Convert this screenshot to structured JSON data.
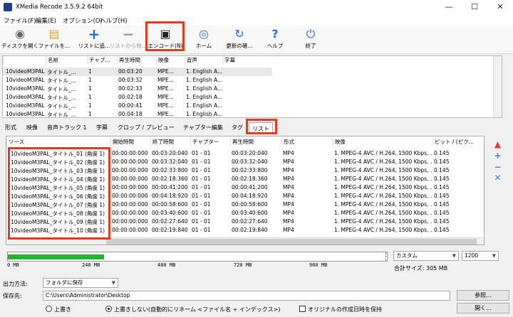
{
  "window": {
    "title": "XMedia Recode 3.5.9.2 64bit"
  },
  "menu": [
    "ファイル(F)",
    "編集(E)",
    "オプション(O)",
    "ヘルプ(H)"
  ],
  "toolbar": [
    {
      "label": "ディスクを開く",
      "icon": "disc-icon",
      "enabled": true
    },
    {
      "label": "ファイルを...",
      "icon": "folder-icon",
      "enabled": true
    },
    {
      "label": "リストに追...",
      "icon": "plus-icon",
      "enabled": true
    },
    {
      "label": "リストから除...",
      "icon": "minus-icon",
      "enabled": false
    },
    {
      "label": "エンコード(N)",
      "icon": "encode-icon",
      "enabled": true
    },
    {
      "label": "ホーム",
      "icon": "globe-icon",
      "enabled": true
    },
    {
      "label": "更新の確...",
      "icon": "refresh-icon",
      "enabled": true
    },
    {
      "label": "ヘルプ",
      "icon": "help-icon",
      "enabled": true
    },
    {
      "label": "終了",
      "icon": "power-icon",
      "enabled": true
    }
  ],
  "file_table": {
    "columns": [
      "",
      "名前",
      "チャプ...",
      "再生時間",
      "映像",
      "音声",
      "字幕"
    ],
    "rows": [
      [
        "10videoM3PAL",
        "タイトル_...",
        "1",
        "00:03:20",
        "MPE...",
        "1. English A...",
        ""
      ],
      [
        "10videoM3PAL",
        "タイトル_...",
        "1",
        "00:03:32",
        "MPE...",
        "1. English A...",
        ""
      ],
      [
        "10videoM3PAL",
        "タイトル_...",
        "1",
        "00:02:33",
        "MPE...",
        "1. English A...",
        ""
      ],
      [
        "10videoM3PAL",
        "タイトル_...",
        "1",
        "00:02:18",
        "MPE...",
        "1. English A...",
        ""
      ],
      [
        "10videoM3PAL",
        "タイトル_...",
        "1",
        "00:00:41",
        "MPE...",
        "1. English A...",
        ""
      ],
      [
        "10videoM3PAL",
        "タイトル_...",
        "1",
        "00:04:18",
        "MPE...",
        "1. English A...",
        ""
      ]
    ]
  },
  "tabs": [
    "形式",
    "映像",
    "音声トラック 1",
    "字幕",
    "クロップ / プレビュー",
    "チャプター編集",
    "タグ",
    "リスト"
  ],
  "list_table": {
    "columns": [
      "ソース",
      "開始時間",
      "終了時間",
      "チャプター",
      "再生時間",
      "形式",
      "映像",
      "ビット / (ピク..."
    ],
    "rows": [
      [
        "10videoM3PAL_タイトル_01 (角度 1)",
        "00:00:00:000",
        "00:03:20:040",
        "01 - 01",
        "00:03:20:040",
        "MP4",
        "1. MPEG-4 AVC / H.264, 1500 Kbps, ....",
        "0.145"
      ],
      [
        "10videoM3PAL_タイトル_02 (角度 1)",
        "00:00:00:000",
        "00:03:32:040",
        "01 - 01",
        "00:03:32:040",
        "MP4",
        "1. MPEG-4 AVC / H.264, 1500 Kbps, ....",
        "0.145"
      ],
      [
        "10videoM3PAL_タイトル_03 (角度 1)",
        "00:00:00:000",
        "00:02:33:800",
        "01 - 01",
        "00:02:33:800",
        "MP4",
        "1. MPEG-4 AVC / H.264, 1500 Kbps, ....",
        "0.145"
      ],
      [
        "10videoM3PAL_タイトル_04 (角度 1)",
        "00:00:00:000",
        "00:02:18:360",
        "01 - 01",
        "00:02:18:360",
        "MP4",
        "1. MPEG-4 AVC / H.264, 1500 Kbps, ....",
        "0.145"
      ],
      [
        "10videoM3PAL_タイトル_05 (角度 1)",
        "00:00:00:000",
        "00:00:41:200",
        "01 - 01",
        "00:00:41:200",
        "MP4",
        "1. MPEG-4 AVC / H.264, 1500 Kbps, ....",
        "0.145"
      ],
      [
        "10videoM3PAL_タイトル_06 (角度 1)",
        "00:00:00:000",
        "00:04:18:920",
        "01 - 01",
        "00:04:18:920",
        "MP4",
        "1. MPEG-4 AVC / H.264, 1500 Kbps, ....",
        "0.145"
      ],
      [
        "10videoM3PAL_タイトル_07 (角度 1)",
        "00:00:00:000",
        "00:00:58:600",
        "01 - 01",
        "00:00:58:600",
        "MP4",
        "1. MPEG-4 AVC / H.264, 1500 Kbps, ....",
        "0.145"
      ],
      [
        "10videoM3PAL_タイトル_08 (角度 1)",
        "00:00:00:000",
        "00:03:40:600",
        "01 - 01",
        "00:03:40:600",
        "MP4",
        "1. MPEG-4 AVC / H.264, 1500 Kbps, ....",
        "0.145"
      ],
      [
        "10videoM3PAL_タイトル_09 (角度 1)",
        "00:00:00:000",
        "00:02:27:640",
        "01 - 01",
        "00:02:27:640",
        "MP4",
        "1. MPEG-4 AVC / H.264, 1500 Kbps, ....",
        "0.145"
      ],
      [
        "10videoM3PAL_タイトル_10 (角度 1)",
        "00:00:00:000",
        "00:02:19:840",
        "01 - 01",
        "00:02:19:840",
        "MP4",
        "1. MPEG-4 AVC / H.264, 1500 Kbps, ....",
        "0.145"
      ]
    ]
  },
  "size_bar": {
    "ticks": [
      "0 MB",
      "240 MB",
      "480 MB",
      "720 MB",
      "960 MB"
    ],
    "fill_mb": 305,
    "limit_mb": 1200,
    "preset": "カスタム",
    "limit_value": "1200",
    "total_label": "合計サイズ: 305 MB"
  },
  "output": {
    "method_label": "出力方法:",
    "method_value": "フォルダに保存",
    "dest_label": "保存先:",
    "dest_path": "C:\\Users\\Administrator\\Desktop",
    "browse_label": "参照...",
    "open_label": "開く...",
    "radio_overwrite": "上書き",
    "radio_no_overwrite": "上書きしない(自動的にリネーム <ファイル名 + インデックス>)",
    "keep_date_label": "オリジナルの作成日時を保持"
  },
  "colors": {
    "highlight": "#e53a1e",
    "fill": "#24b52a",
    "accent": "#4a7fd1"
  }
}
